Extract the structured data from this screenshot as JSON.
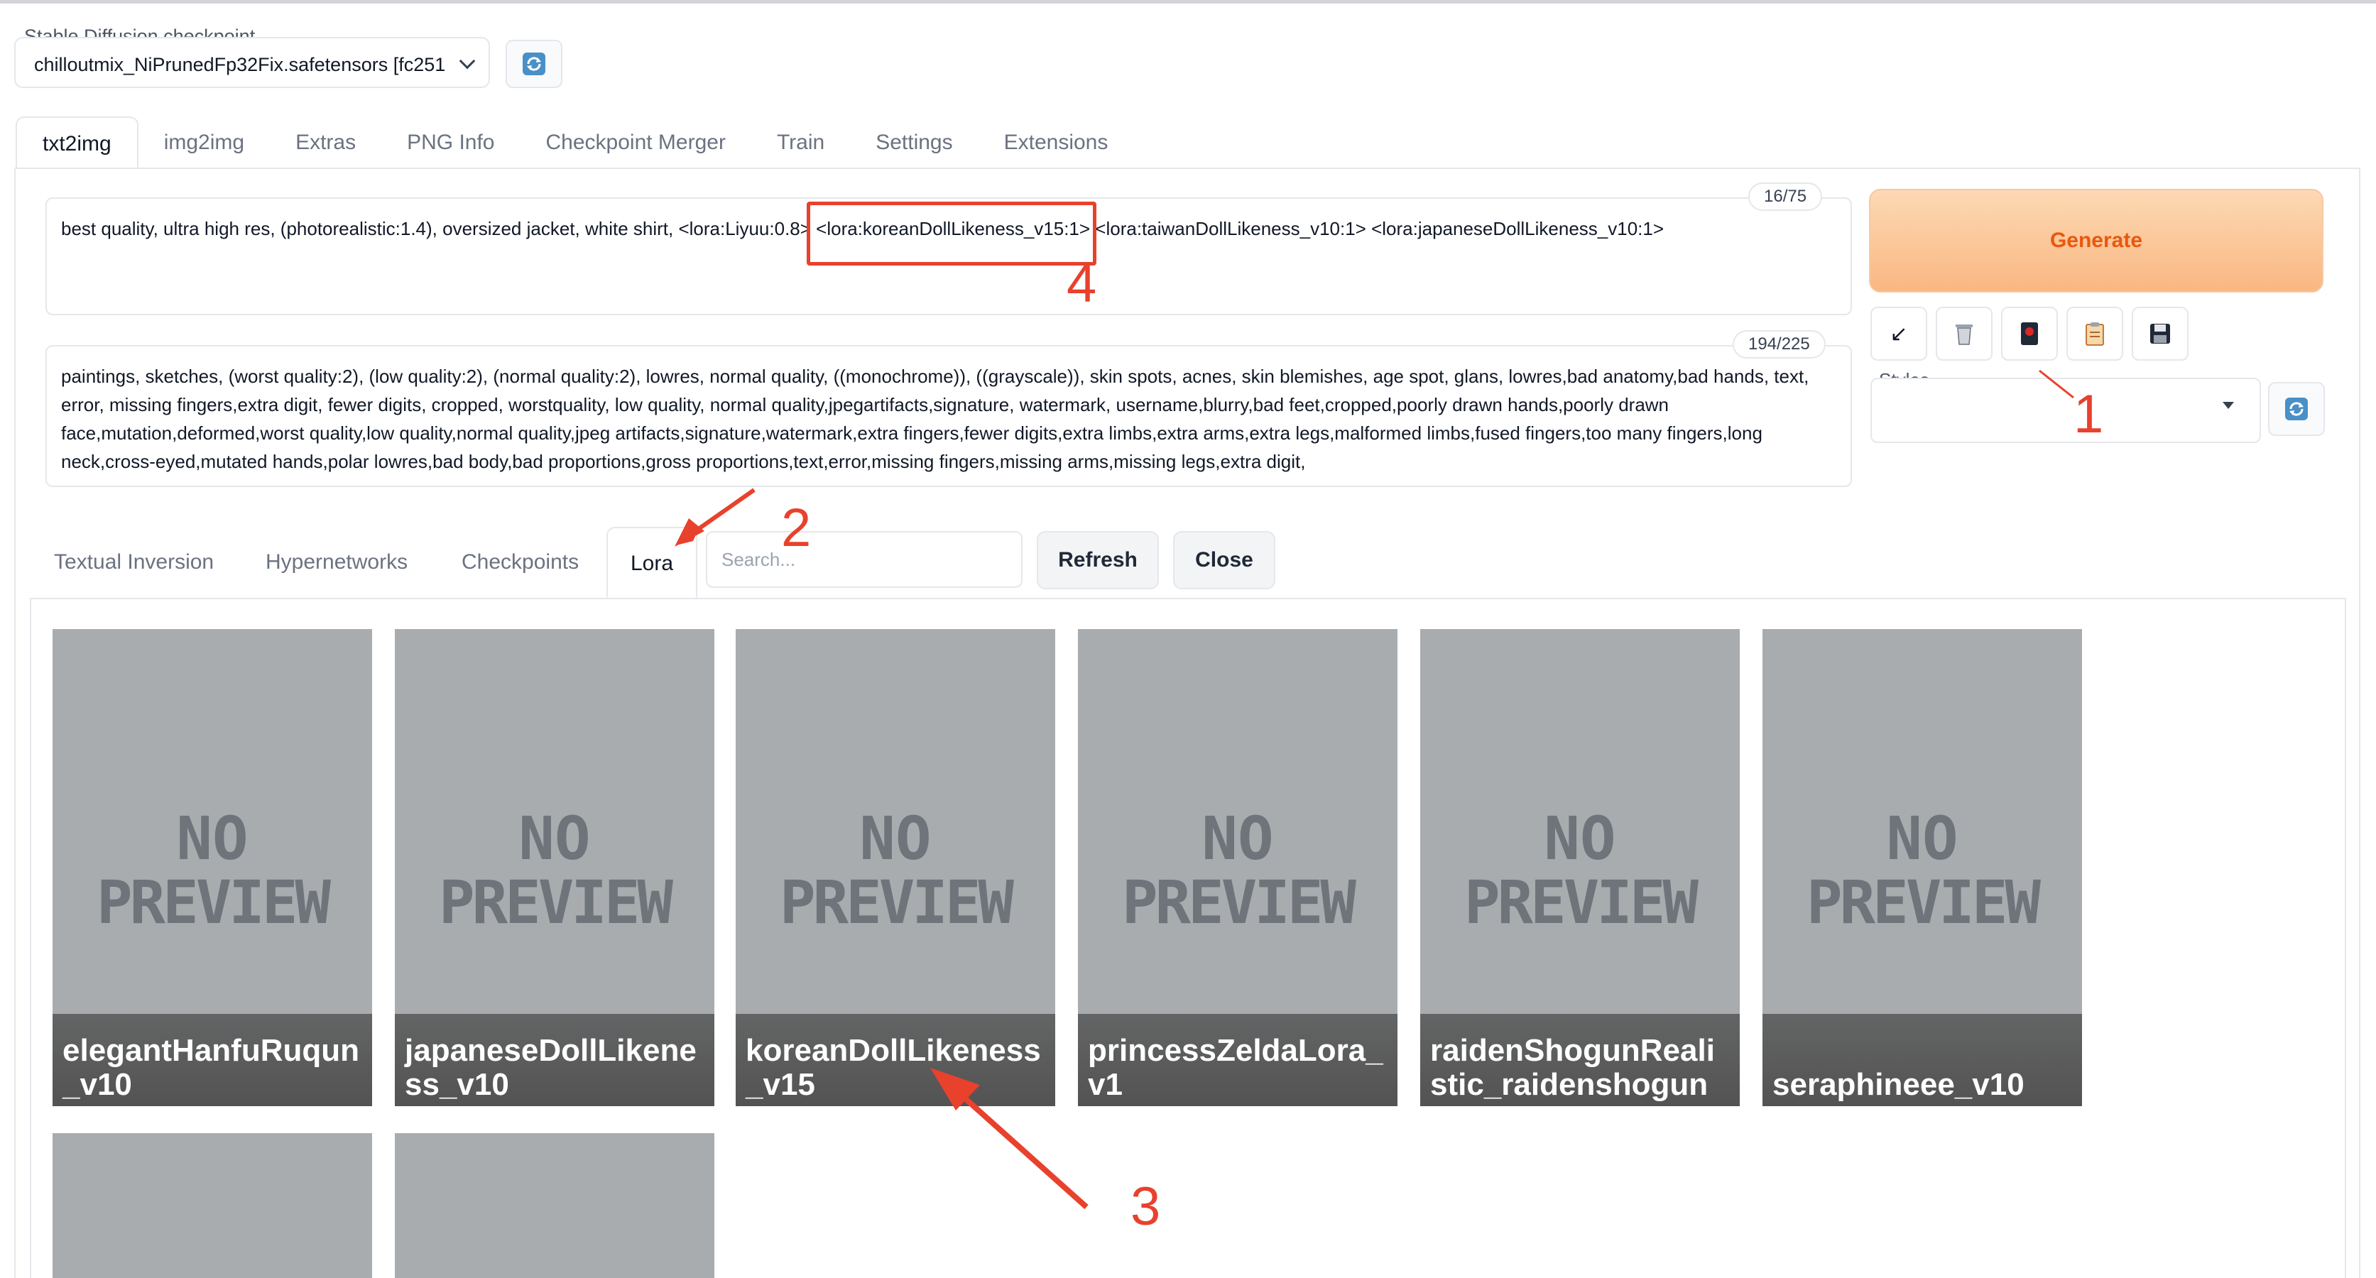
{
  "checkpoint": {
    "label": "Stable Diffusion checkpoint",
    "value": "chilloutmix_NiPrunedFp32Fix.safetensors [fc251"
  },
  "main_tabs": [
    "txt2img",
    "img2img",
    "Extras",
    "PNG Info",
    "Checkpoint Merger",
    "Train",
    "Settings",
    "Extensions"
  ],
  "prompt": {
    "text": "best quality, ultra high res, (photorealistic:1.4), oversized jacket, white shirt, <lora:Liyuu:0.8> <lora:koreanDollLikeness_v15:1> <lora:taiwanDollLikeness_v10:1> <lora:japaneseDollLikeness_v10:1>",
    "counter": "16/75"
  },
  "negative_prompt": {
    "text": "paintings, sketches, (worst quality:2), (low quality:2), (normal quality:2), lowres, normal quality, ((monochrome)), ((grayscale)), skin spots, acnes, skin blemishes, age spot, glans, lowres,bad anatomy,bad hands, text, error, missing fingers,extra digit, fewer digits, cropped, worstquality, low quality, normal quality,jpegartifacts,signature, watermark, username,blurry,bad feet,cropped,poorly drawn hands,poorly drawn face,mutation,deformed,worst quality,low quality,normal quality,jpeg artifacts,signature,watermark,extra fingers,fewer digits,extra limbs,extra arms,extra legs,malformed limbs,fused fingers,too many fingers,long neck,cross-eyed,mutated hands,polar lowres,bad body,bad proportions,gross proportions,text,error,missing fingers,missing arms,missing legs,extra digit,",
    "counter": "194/225"
  },
  "generate_label": "Generate",
  "styles_label": "Styles",
  "extra_networks": {
    "tabs": [
      "Textual Inversion",
      "Hypernetworks",
      "Checkpoints",
      "Lora"
    ],
    "search_placeholder": "Search...",
    "refresh_label": "Refresh",
    "close_label": "Close"
  },
  "no_preview": {
    "line1": "NO",
    "line2": "PREVIEW"
  },
  "cards": [
    {
      "name": "elegantHanfuRuqun_v10"
    },
    {
      "name": "japaneseDollLikeness_v10"
    },
    {
      "name": "koreanDollLikeness_v15"
    },
    {
      "name": "princessZeldaLora_v1"
    },
    {
      "name": "raidenShogunRealistic_raidenshogun"
    },
    {
      "name": "seraphineee_v10"
    }
  ],
  "annotations": {
    "a1": "1",
    "a2": "2",
    "a3": "3",
    "a4": "4"
  },
  "colors": {
    "accent": "#ea580c",
    "annotation": "#e8412c",
    "card_bg": "#a9acaf"
  }
}
